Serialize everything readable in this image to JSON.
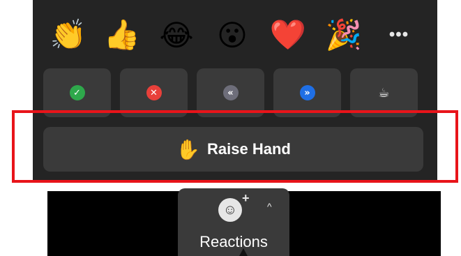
{
  "emoji_reactions": [
    {
      "name": "clap",
      "glyph": "👏"
    },
    {
      "name": "thumbs-up",
      "glyph": "👍"
    },
    {
      "name": "joy",
      "glyph": "😂"
    },
    {
      "name": "open-mouth",
      "glyph": "😮"
    },
    {
      "name": "heart",
      "glyph": "❤️"
    },
    {
      "name": "tada",
      "glyph": "🎉"
    }
  ],
  "more_label": "•••",
  "feedback": [
    {
      "name": "yes",
      "glyph": "✓",
      "color": "#2ea84b"
    },
    {
      "name": "no",
      "glyph": "✕",
      "color": "#e8403a"
    },
    {
      "name": "slow-down",
      "glyph": "«",
      "color": "#6e6e7a"
    },
    {
      "name": "speed-up",
      "glyph": "»",
      "color": "#1f6fe5"
    },
    {
      "name": "coffee",
      "glyph": "☕",
      "color": "#3a3a3a"
    }
  ],
  "raise_hand": {
    "label": "Raise Hand",
    "icon": "✋"
  },
  "reactions_button": {
    "label": "Reactions",
    "caret": "^"
  },
  "highlight_color": "#e8141a"
}
